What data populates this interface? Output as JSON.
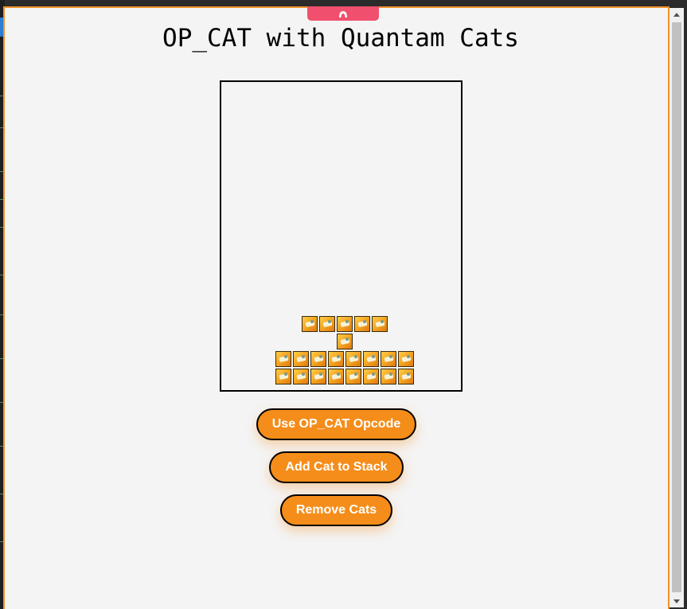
{
  "title": "OP_CAT with Quantam Cats",
  "buttons": {
    "opcat": "Use OP_CAT Opcode",
    "add": "Add Cat to Stack",
    "remove": "Remove Cats"
  },
  "colors": {
    "frame": "#f0922b",
    "button_bg": "#f58d1a",
    "drag_tab": "#f0506e",
    "page_bg": "#f4f4f4"
  },
  "icons": {
    "drag_tab": "chevron-up-icon",
    "cat_tile": "quantum-cat-icon",
    "scroll_up": "scroll-up-arrow-icon",
    "scroll_down": "scroll-down-arrow-icon"
  },
  "stack": {
    "rows": [
      {
        "cats": 5
      },
      {
        "cats": 1
      },
      {
        "cats": 8
      },
      {
        "cats": 8
      }
    ]
  }
}
